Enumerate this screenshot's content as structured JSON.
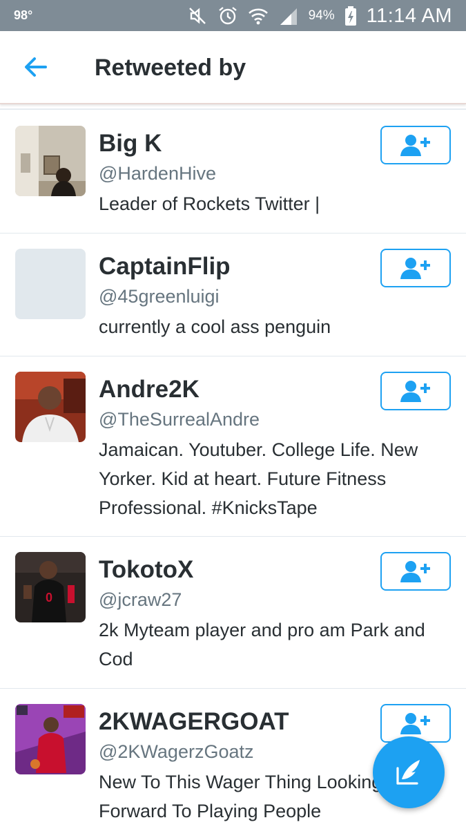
{
  "status_bar": {
    "temperature": "98°",
    "battery_percent": "94%",
    "time": "11:14 AM"
  },
  "header": {
    "title": "Retweeted by"
  },
  "colors": {
    "accent": "#1da1f2",
    "status_bar": "#7f8c96"
  },
  "users": [
    {
      "name": "Big K",
      "handle": "@HardenHive",
      "bio": "Leader of Rockets Twitter |"
    },
    {
      "name": "CaptainFlip",
      "handle": "@45greenluigi",
      "bio": "currently a cool ass penguin"
    },
    {
      "name": "Andre2K",
      "handle": "@TheSurrealAndre",
      "bio": "Jamaican. Youtuber. College Life. New Yorker. Kid at heart. Future Fitness Professional. #KnicksTape"
    },
    {
      "name": "TokotoX",
      "handle": "@jcraw27",
      "bio": "2k Myteam player and pro am Park and Cod"
    },
    {
      "name": "2KWAGERGOAT",
      "handle": "@2KWagerzGoatz",
      "bio": "New To This Wager Thing Looking Forward To Playing People"
    }
  ],
  "icons": {
    "back": "arrow-left-icon",
    "follow": "add-user-icon",
    "compose": "compose-tweet-icon"
  }
}
